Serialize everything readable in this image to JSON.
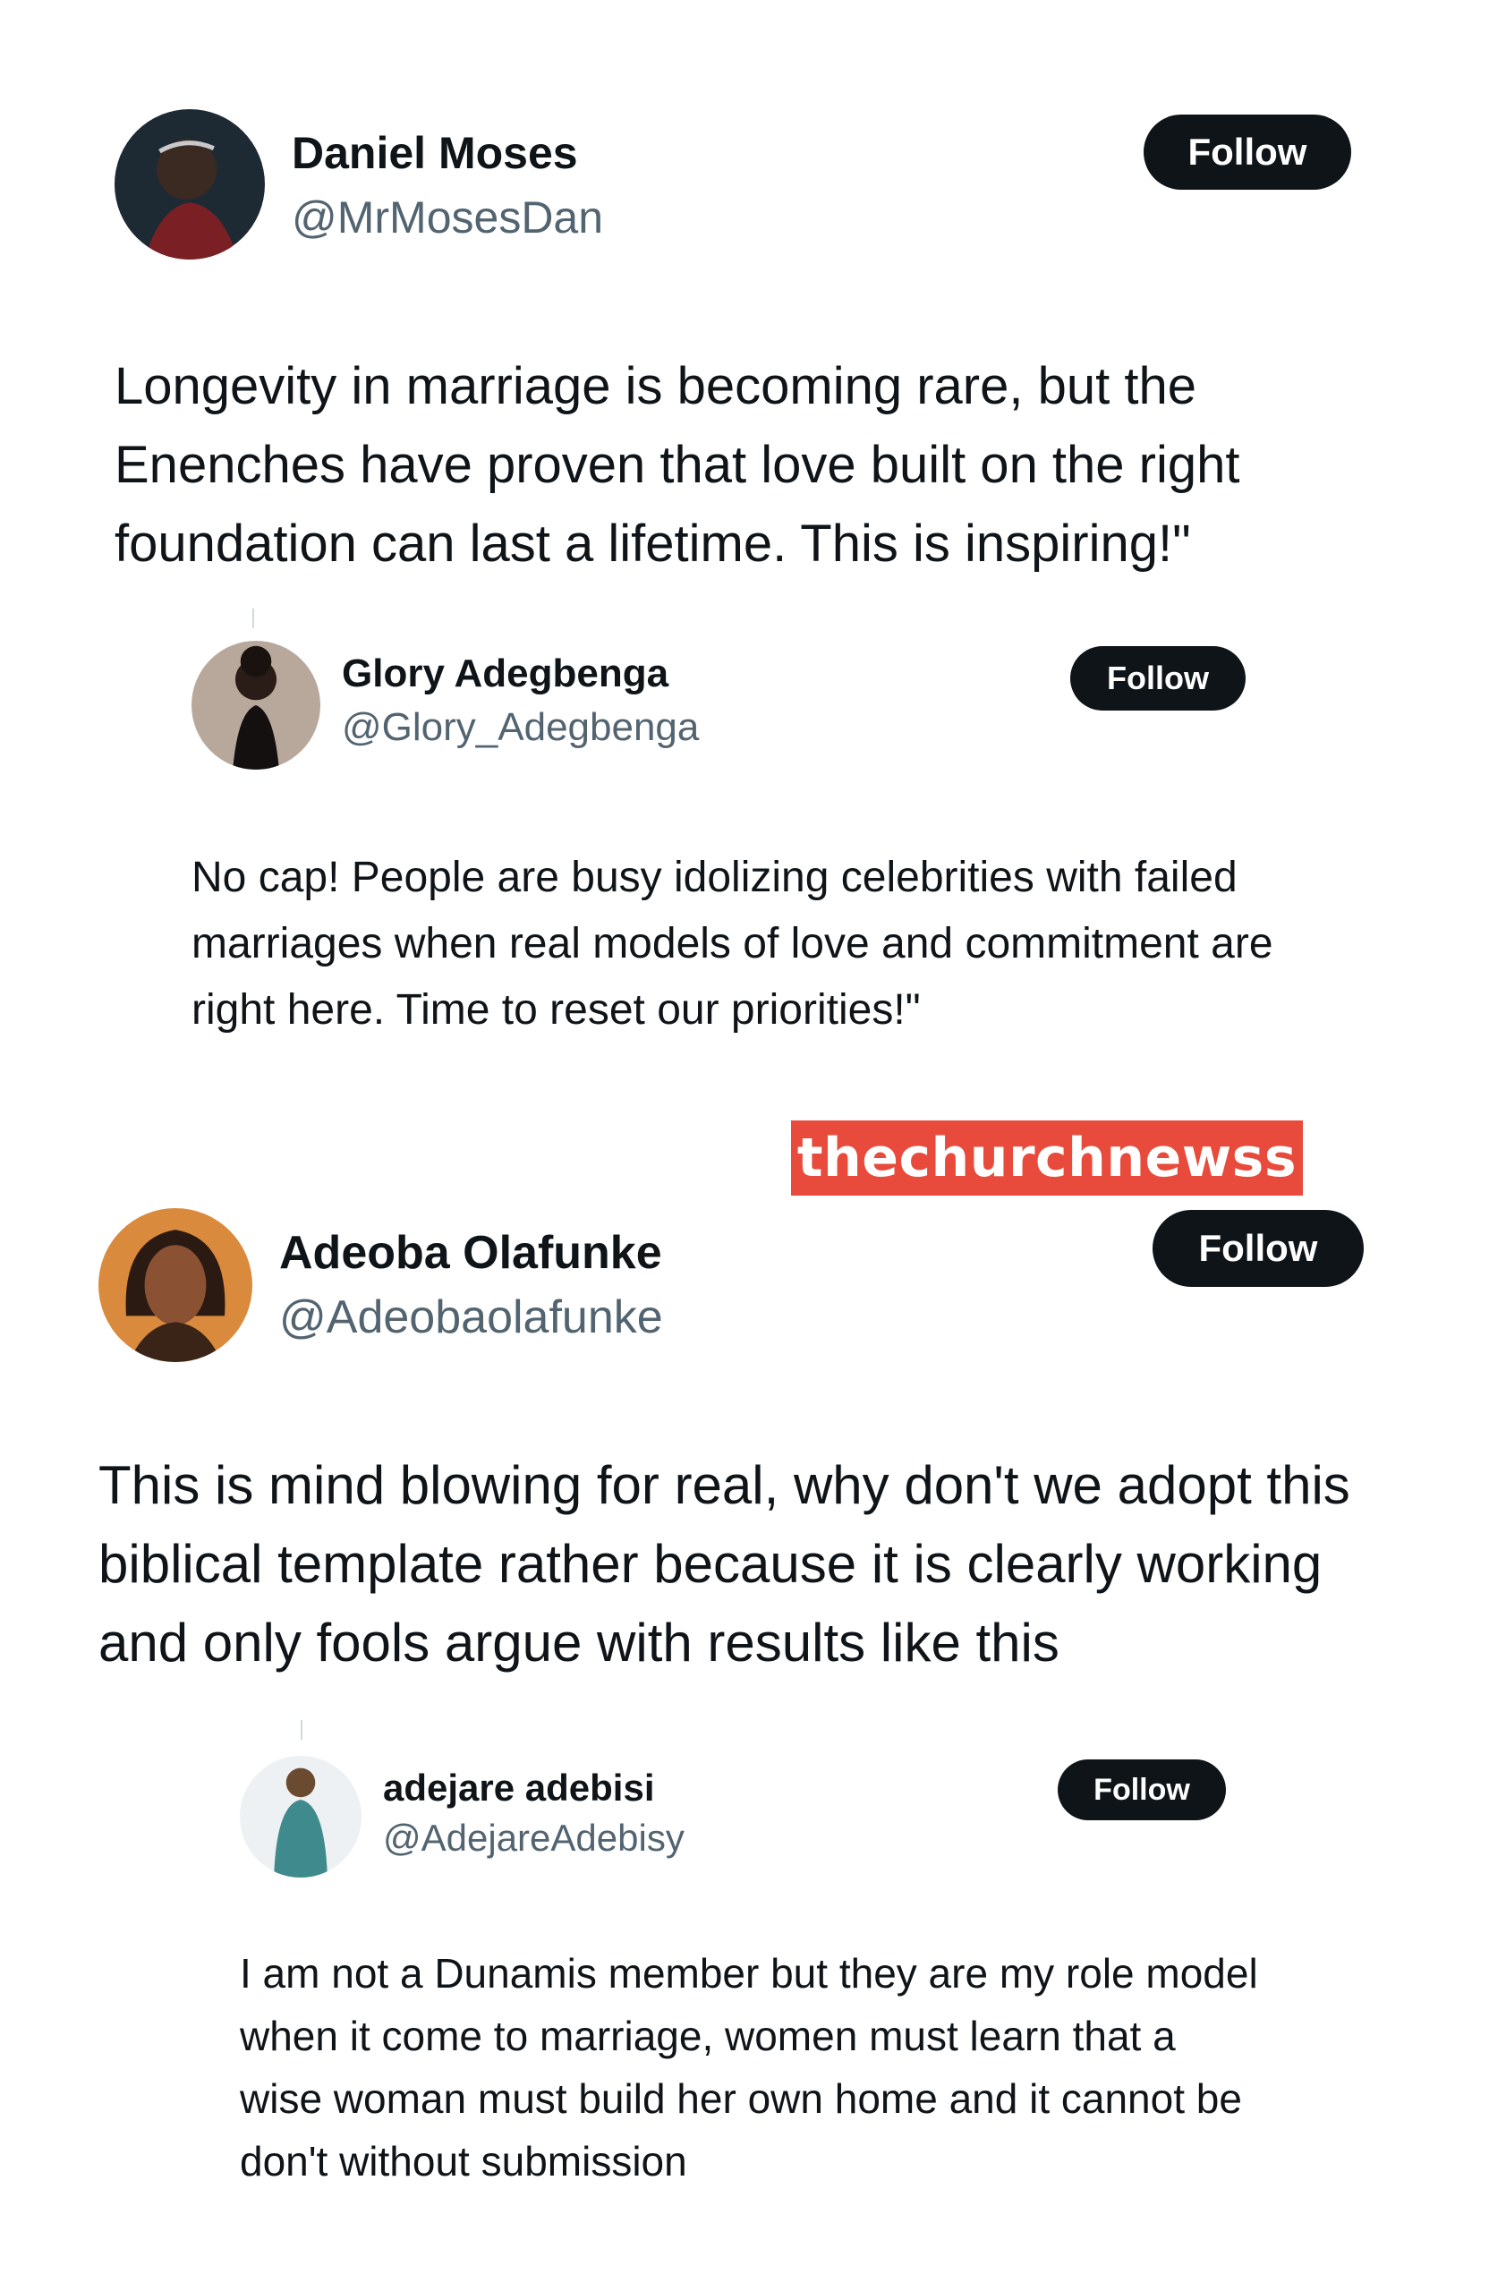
{
  "posts": [
    {
      "name": "Daniel Moses",
      "handle": "@MrMosesDan",
      "follow_label": "Follow",
      "text": "Longevity in marriage is becoming rare, but the Enenches have proven that love built on the right foundation can last a lifetime. This is inspiring!\""
    },
    {
      "name": "Glory Adegbenga",
      "handle": "@Glory_Adegbenga",
      "follow_label": "Follow",
      "text": "No cap! People are busy idolizing celebrities with failed marriages when real models of love and commitment are right here. Time to reset our priorities!\""
    },
    {
      "name": "Adeoba Olafunke",
      "handle": "@Adeobaolafunke",
      "follow_label": "Follow",
      "text": "This is mind blowing for real, why don't we adopt this biblical template rather because it is clearly working and only fools argue with results like this"
    },
    {
      "name": "adejare adebisi",
      "handle": "@AdejareAdebisy",
      "follow_label": "Follow",
      "text": "I am not a Dunamis member but they are my role model when it come to marriage, women must learn that a wise woman must build her own home and it cannot be don't without submission"
    }
  ],
  "watermark": "thechurchnewss",
  "colors": {
    "button_bg": "#0f1419",
    "handle": "#536471",
    "watermark_bg": "#e84b3c"
  }
}
